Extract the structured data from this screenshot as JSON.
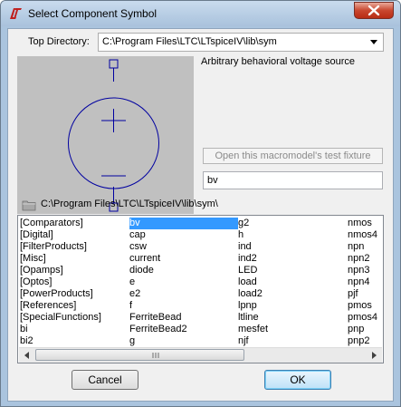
{
  "window": {
    "title": "Select Component Symbol",
    "logo_icon": "ltspice-logo-icon",
    "close_icon": "close-icon"
  },
  "top_directory": {
    "label": "Top Directory:",
    "value": "C:\\Program Files\\LTC\\LTspiceIV\\lib\\sym"
  },
  "symbol": {
    "description": "Arbitrary behavioral voltage source",
    "test_fixture_label": "Open this macromodel's test fixture",
    "name_value": "bv"
  },
  "path": {
    "text": "C:\\Program Files\\LTC\\LTspiceIV\\lib\\sym\\",
    "icon": "folder-icon"
  },
  "list": {
    "selected": "bv",
    "columns": [
      [
        "[Comparators]",
        "[Digital]",
        "[FilterProducts]",
        "[Misc]",
        "[Opamps]",
        "[Optos]",
        "[PowerProducts]",
        "[References]",
        "[SpecialFunctions]",
        "bi",
        "bi2"
      ],
      [
        "bv",
        "cap",
        "csw",
        "current",
        "diode",
        "e",
        "e2",
        "f",
        "FerriteBead",
        "FerriteBead2",
        "g"
      ],
      [
        "g2",
        "h",
        "ind",
        "ind2",
        "LED",
        "load",
        "load2",
        "lpnp",
        "ltline",
        "mesfet",
        "njf"
      ],
      [
        "nmos",
        "nmos4",
        "npn",
        "npn2",
        "npn3",
        "npn4",
        "pjf",
        "pmos",
        "pmos4",
        "pnp",
        "pnp2"
      ]
    ]
  },
  "buttons": {
    "cancel": "Cancel",
    "ok": "OK"
  },
  "colors": {
    "symbol_stroke": "#0000a0",
    "preview_bg": "#c0c0c0",
    "selection": "#3399ff"
  }
}
